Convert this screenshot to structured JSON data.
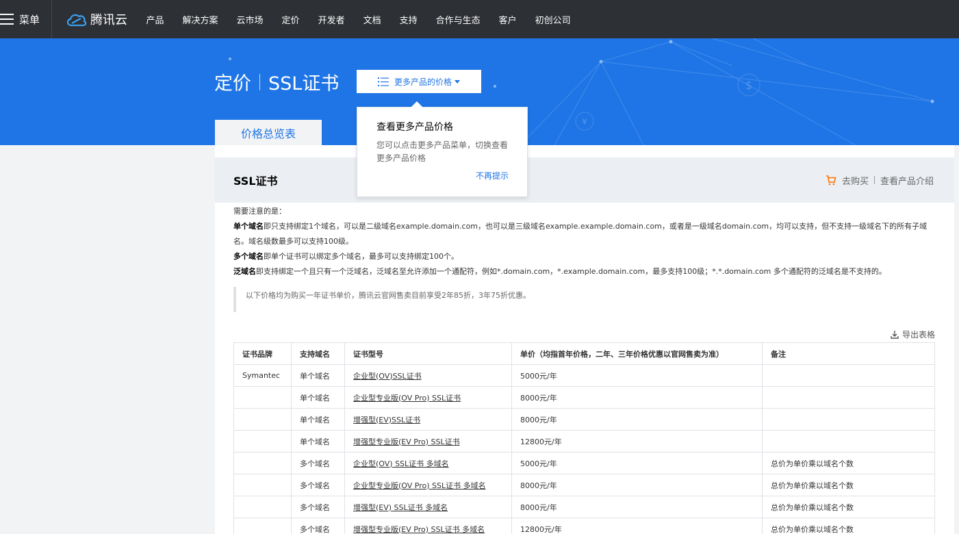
{
  "nav": {
    "menu_label": "菜单",
    "logo_text": "腾讯云",
    "items": [
      "产品",
      "解决方案",
      "云市场",
      "定价",
      "开发者",
      "文档",
      "支持",
      "合作与生态",
      "客户",
      "初创公司"
    ]
  },
  "banner": {
    "title_left": "定价",
    "title_right": "SSL证书",
    "more_button": "更多产品的价格",
    "tab": "价格总览表"
  },
  "popover": {
    "title": "查看更多产品价格",
    "body": "您可以点击更多产品菜单，切换查看更多产品价格",
    "dismiss": "不再提示"
  },
  "card": {
    "title": "SSL证书",
    "buy": "去购买",
    "intro": "查看产品介绍",
    "notes_intro": "需要注意的是：",
    "note1_bold": "单个域名",
    "note1_text": "即只支持绑定1个域名，可以是二级域名example.domain.com，也可以是三级域名example.example.domain.com，或者是一级域名domain.com，均可以支持，但不支持一级域名下的所有子域名。域名级数最多可以支持100级。",
    "note2_bold": "多个域名",
    "note2_text": "即单个证书可以绑定多个域名，最多可以支持绑定100个。",
    "note3_bold": "泛域名",
    "note3_text": "即支持绑定一个且只有一个泛域名，泛域名至允许添加一个通配符，例如*.domain.com，*.example.domain.com，最多支持100级；*.*.domain.com 多个通配符的泛域名是不支持的。",
    "quote": "以下价格均为购买一年证书单价，腾讯云官网售卖目前享受2年85折，3年75折优惠。",
    "export": "导出表格"
  },
  "table": {
    "headers": [
      "证书品牌",
      "支持域名",
      "证书型号",
      "单价（均指首年价格，二年、三年价格优惠以官网售卖为准）",
      "备注"
    ],
    "rows": [
      [
        "Symantec",
        "单个域名",
        "企业型(OV)SSL证书",
        "5000元/年",
        ""
      ],
      [
        "",
        "单个域名",
        "企业型专业版(OV Pro) SSL证书",
        "8000元/年",
        ""
      ],
      [
        "",
        "单个域名",
        "增强型(EV)SSL证书",
        "8000元/年",
        ""
      ],
      [
        "",
        "单个域名",
        "增强型专业版(EV Pro) SSL证书",
        "12800元/年",
        ""
      ],
      [
        "",
        "多个域名",
        "企业型(OV) SSL证书 多域名",
        "5000元/年",
        "总价为单价乘以域名个数"
      ],
      [
        "",
        "多个域名",
        "企业型专业版(OV Pro) SSL证书 多域名",
        "8000元/年",
        "总价为单价乘以域名个数"
      ],
      [
        "",
        "多个域名",
        "增强型(EV) SSL证书 多域名",
        "8000元/年",
        "总价为单价乘以域名个数"
      ],
      [
        "",
        "多个域名",
        "增强型专业版(EV Pro) SSL证书 多域名",
        "12800元/年",
        "总价为单价乘以域名个数"
      ]
    ]
  },
  "colors": {
    "brand": "#1f75e6",
    "nav_bg": "#2d3035",
    "cart": "#ff7200"
  }
}
